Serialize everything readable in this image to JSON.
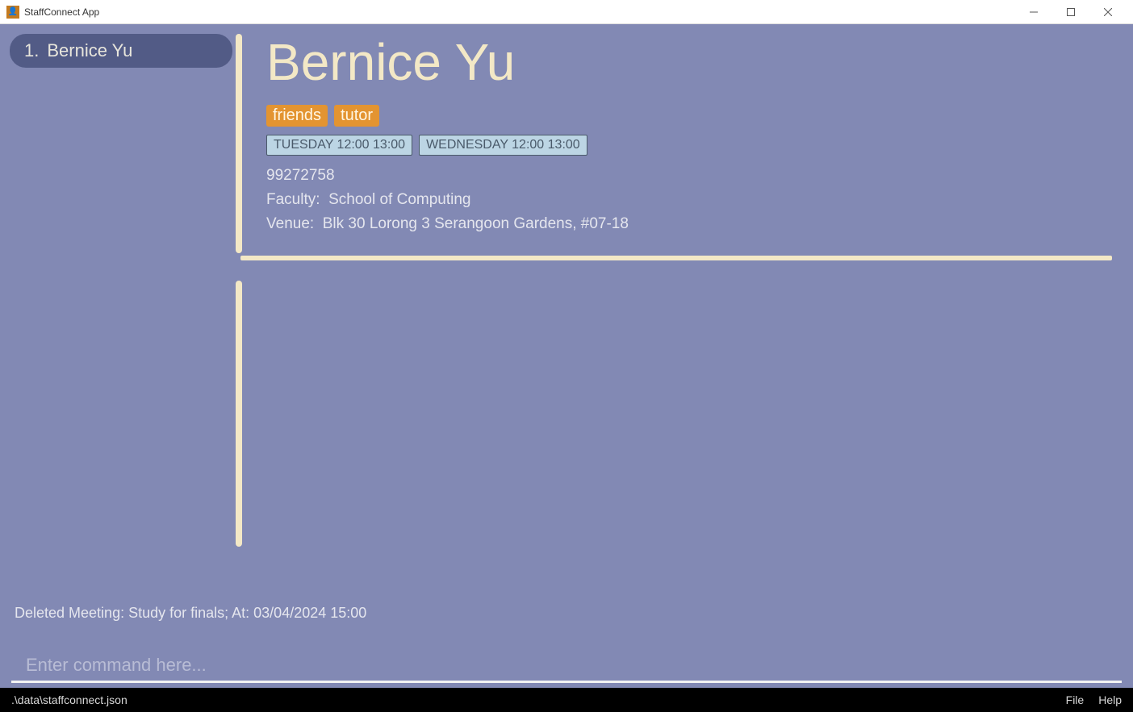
{
  "window": {
    "title": "StaffConnect App"
  },
  "personList": {
    "items": [
      {
        "index": "1.",
        "name": "Bernice Yu"
      }
    ]
  },
  "detail": {
    "name": "Bernice Yu",
    "tags": [
      "friends",
      "tutor"
    ],
    "slots": [
      "TUESDAY 12:00 13:00",
      "WEDNESDAY 12:00 13:00"
    ],
    "phone": "99272758",
    "facultyLabel": "Faculty:",
    "faculty": "School of Computing",
    "venueLabel": "Venue:",
    "venue": "Blk 30 Lorong 3 Serangoon Gardens, #07-18"
  },
  "result": {
    "message": "Deleted Meeting: Study for finals; At: 03/04/2024 15:00"
  },
  "command": {
    "placeholder": "Enter command here..."
  },
  "statusbar": {
    "path": ".\\data\\staffconnect.json",
    "menu": {
      "file": "File",
      "help": "Help"
    }
  }
}
